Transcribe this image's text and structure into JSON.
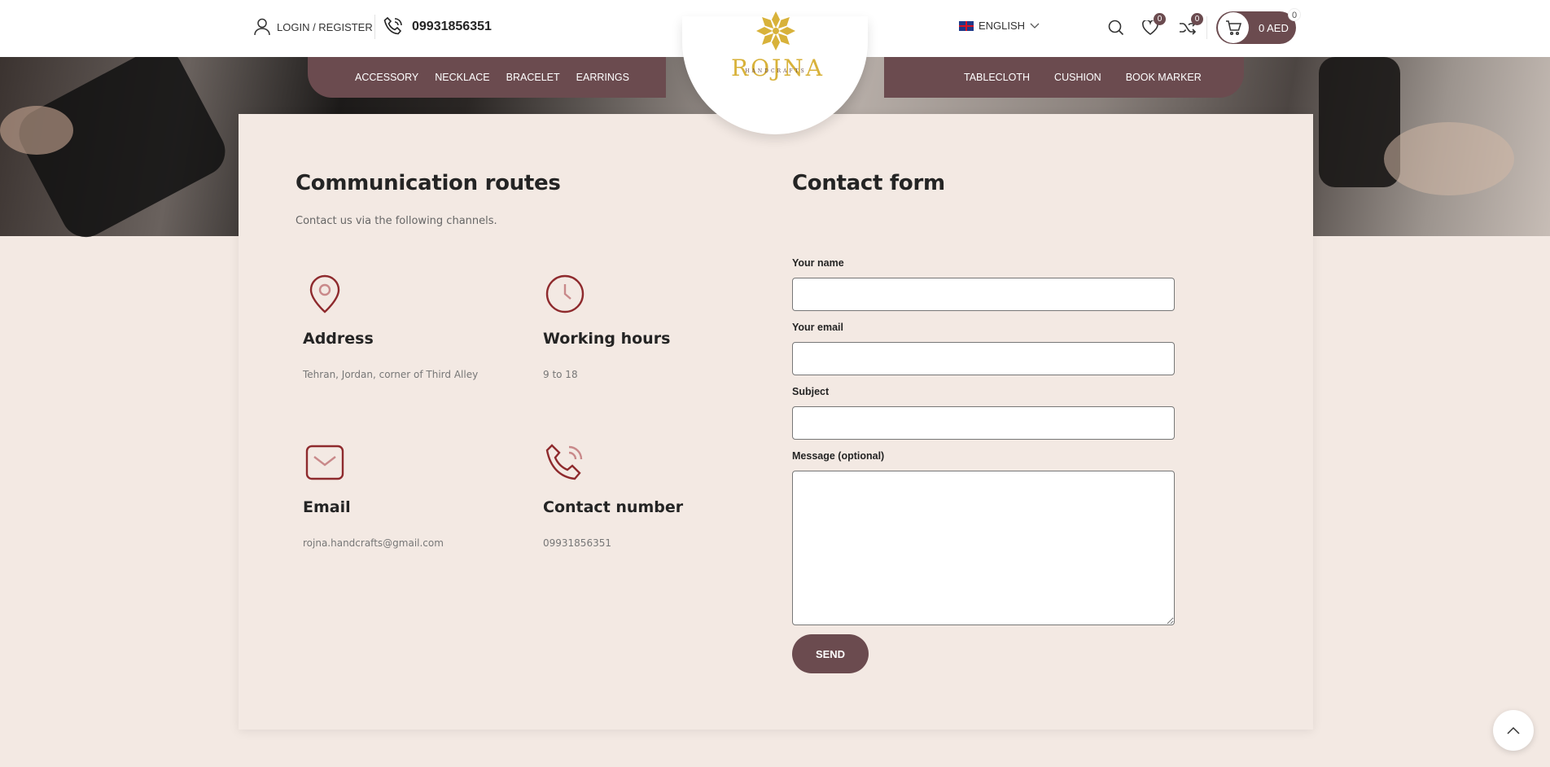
{
  "header": {
    "login_label": "LOGIN / REGISTER",
    "phone": "09931856351",
    "language": "ENGLISH",
    "wishlist_count": "0",
    "compare_count": "0",
    "cart_amount": "0 AED",
    "cart_count": "0"
  },
  "logo": {
    "name": "ROJNA",
    "subtitle": "HANDCRAFTS"
  },
  "nav": {
    "left": [
      "ACCESSORY",
      "NECKLACE",
      "BRACELET",
      "EARRINGS"
    ],
    "right": [
      "TABLECLOTH",
      "CUSHION",
      "BOOK MARKER"
    ]
  },
  "routes": {
    "title": "Communication routes",
    "subtitle": "Contact us via the following channels.",
    "items": [
      {
        "icon": "location-pin-icon",
        "title": "Address",
        "value": "Tehran, Jordan, corner of Third Alley"
      },
      {
        "icon": "clock-icon",
        "title": "Working hours",
        "value": "9 to 18"
      },
      {
        "icon": "envelope-icon",
        "title": "Email",
        "value": "rojna.handcrafts@gmail.com"
      },
      {
        "icon": "phone-icon",
        "title": "Contact number",
        "value": "09931856351"
      }
    ]
  },
  "form": {
    "title": "Contact form",
    "name_label": "Your name",
    "name_value": "",
    "email_label": "Your email",
    "email_value": "",
    "subject_label": "Subject",
    "subject_value": "",
    "message_label": "Message (optional)",
    "message_value": "",
    "send_label": "SEND"
  },
  "colors": {
    "brand": "#6b4b4f",
    "accent_icon": "#8e2a2d",
    "logo_gold": "#d8b23a",
    "background": "#f3e9e3"
  }
}
